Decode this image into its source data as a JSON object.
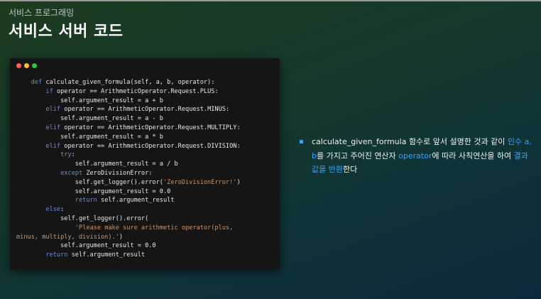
{
  "header": {
    "subtitle": "서비스 프로그래밍",
    "title": "서비스 서버 코드"
  },
  "colors": {
    "dot_red": "#ff5f57",
    "dot_yellow": "#febc2e",
    "dot_green": "#28c840",
    "keyword": "#6e8cd6",
    "string": "#c99772",
    "highlight": "#3aa0ff"
  },
  "code_lines": [
    [
      {
        "t": "    "
      },
      {
        "t": "def",
        "c": "kw"
      },
      {
        "t": " calculate_given_formula(self, a, b, operator):"
      }
    ],
    [
      {
        "t": "        "
      },
      {
        "t": "if",
        "c": "kw"
      },
      {
        "t": " operator == ArithmeticOperator.Request.PLUS:"
      }
    ],
    [
      {
        "t": "            self.argument_result = a + b"
      }
    ],
    [
      {
        "t": "        "
      },
      {
        "t": "elif",
        "c": "kw"
      },
      {
        "t": " operator == ArithmeticOperator.Request.MINUS:"
      }
    ],
    [
      {
        "t": "            self.argument_result = a - b"
      }
    ],
    [
      {
        "t": "        "
      },
      {
        "t": "elif",
        "c": "kw"
      },
      {
        "t": " operator == ArithmeticOperator.Request.MULTIPLY:"
      }
    ],
    [
      {
        "t": "            self.argument_result = a * b"
      }
    ],
    [
      {
        "t": "        "
      },
      {
        "t": "elif",
        "c": "kw"
      },
      {
        "t": " operator == ArithmeticOperator.Request.DIVISION:"
      }
    ],
    [
      {
        "t": "            "
      },
      {
        "t": "try",
        "c": "kw"
      },
      {
        "t": ":"
      }
    ],
    [
      {
        "t": "                self.argument_result = a / b"
      }
    ],
    [
      {
        "t": "            "
      },
      {
        "t": "except",
        "c": "kw"
      },
      {
        "t": " ZeroDivisionError:"
      }
    ],
    [
      {
        "t": "                self.get_logger().error("
      },
      {
        "t": "'ZeroDivisionError!'",
        "c": "str"
      },
      {
        "t": ")"
      }
    ],
    [
      {
        "t": "                self.argument_result = 0.0"
      }
    ],
    [
      {
        "t": "                "
      },
      {
        "t": "return",
        "c": "kw"
      },
      {
        "t": " self.argument_result"
      }
    ],
    [
      {
        "t": "        "
      },
      {
        "t": "else",
        "c": "kw"
      },
      {
        "t": ":"
      }
    ],
    [
      {
        "t": "            self.get_logger().error("
      }
    ],
    [
      {
        "t": "                "
      },
      {
        "t": "'Please make sure arithmetic operator(plus,",
        "c": "str"
      }
    ],
    [
      {
        "t": "minus, multiply, division).'",
        "c": "str"
      },
      {
        "t": ")"
      }
    ],
    [
      {
        "t": "            self.argument_result = 0.0"
      }
    ],
    [
      {
        "t": "        "
      },
      {
        "t": "return",
        "c": "kw"
      },
      {
        "t": " self.argument_result"
      }
    ]
  ],
  "description": [
    {
      "t": "calculate_given_formula 함수로 앞서 설명한 것과 같이 "
    },
    {
      "t": "인수 a, b",
      "c": "hl"
    },
    {
      "t": "를 가지고 주어진 연산자 "
    },
    {
      "t": "operator",
      "c": "hl"
    },
    {
      "t": "에 따라 사칙연산을 하여 "
    },
    {
      "t": "결과값을 반환",
      "c": "hl"
    },
    {
      "t": "한다"
    }
  ]
}
